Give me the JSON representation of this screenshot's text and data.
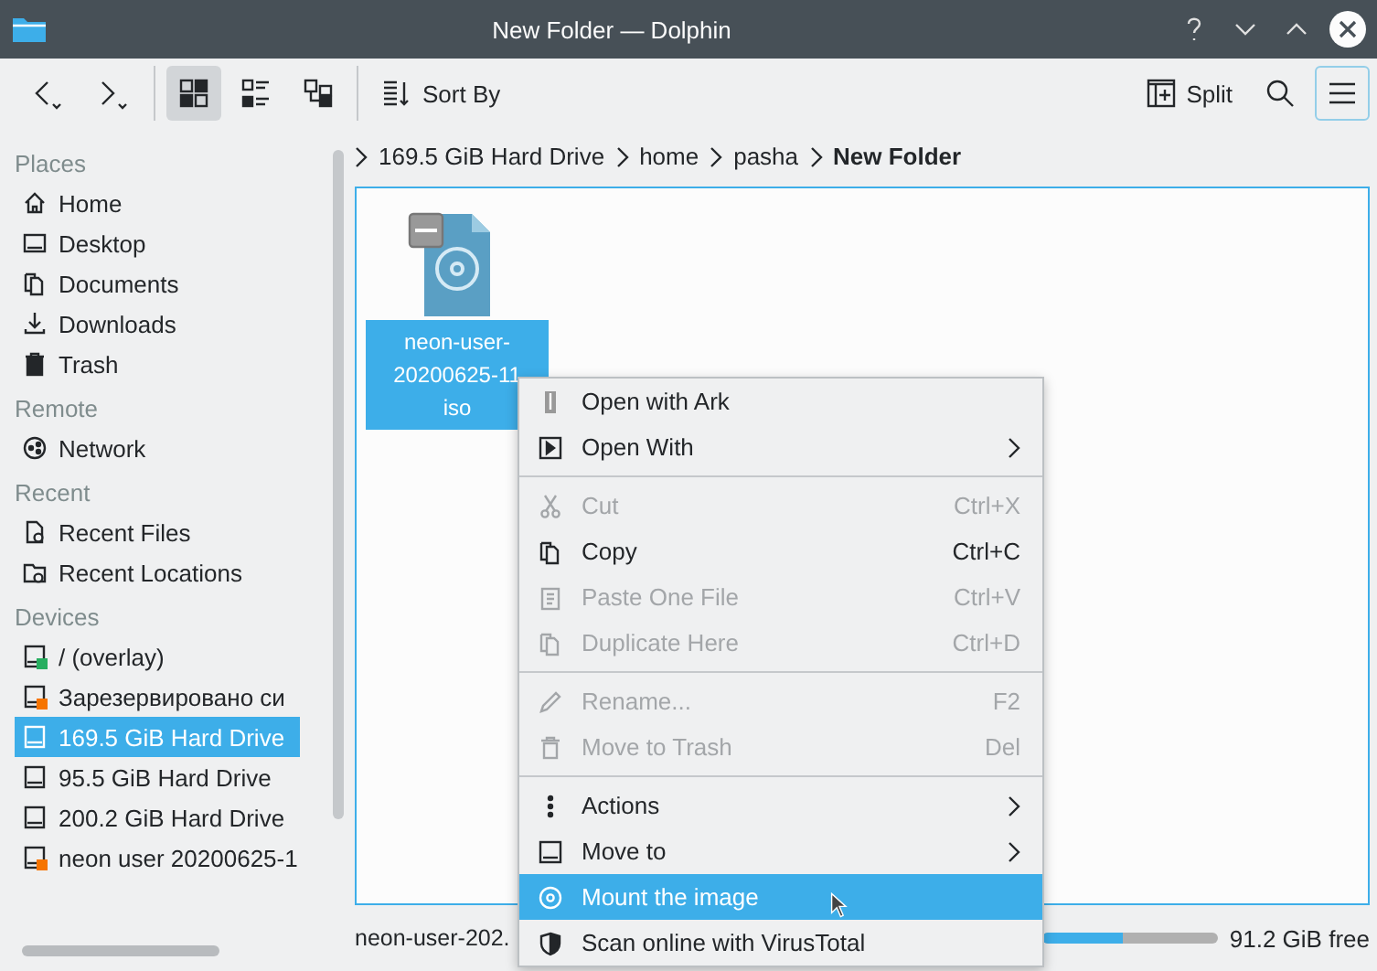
{
  "window": {
    "title": "New Folder — Dolphin"
  },
  "toolbar": {
    "views": [
      {
        "selected": true
      },
      {
        "selected": false
      },
      {
        "selected": false
      }
    ],
    "sort_label": "Sort By",
    "split_label": "Split"
  },
  "sidebar": {
    "sections": [
      {
        "title": "Places",
        "items": [
          {
            "label": "Home",
            "selected": false
          },
          {
            "label": "Desktop",
            "selected": false
          },
          {
            "label": "Documents",
            "selected": false
          },
          {
            "label": "Downloads",
            "selected": false
          },
          {
            "label": "Trash",
            "selected": false
          }
        ]
      },
      {
        "title": "Remote",
        "items": [
          {
            "label": "Network",
            "selected": false
          }
        ]
      },
      {
        "title": "Recent",
        "items": [
          {
            "label": "Recent Files",
            "selected": false
          },
          {
            "label": "Recent Locations",
            "selected": false
          }
        ]
      },
      {
        "title": "Devices",
        "items": [
          {
            "label": "/ (overlay)",
            "selected": false
          },
          {
            "label": "Зарезервировано си",
            "selected": false
          },
          {
            "label": "169.5 GiB Hard Drive",
            "selected": true
          },
          {
            "label": "95.5 GiB Hard Drive",
            "selected": false
          },
          {
            "label": "200.2 GiB Hard Drive",
            "selected": false
          },
          {
            "label": "neon user 20200625-1",
            "selected": false
          }
        ]
      }
    ]
  },
  "breadcrumb": [
    "169.5 GiB Hard Drive",
    "home",
    "pasha",
    "New Folder"
  ],
  "file": {
    "lines": [
      "neon-user-",
      "20200625-11",
      "iso"
    ],
    "selected": true
  },
  "status_bar": {
    "text": "neon-user-202.",
    "free": "91.2 GiB free",
    "level": 0.45
  },
  "context_menu": [
    {
      "kind": "item",
      "label": "Open with Ark",
      "disabled": false,
      "submenu": false,
      "selected": false
    },
    {
      "kind": "item",
      "label": "Open With",
      "disabled": false,
      "submenu": true,
      "selected": false
    },
    {
      "kind": "separator"
    },
    {
      "kind": "item",
      "label": "Cut",
      "shortcut": "Ctrl+X",
      "disabled": true,
      "submenu": false,
      "selected": false
    },
    {
      "kind": "item",
      "label": "Copy",
      "shortcut": "Ctrl+C",
      "disabled": false,
      "submenu": false,
      "selected": false
    },
    {
      "kind": "item",
      "label": "Paste One File",
      "shortcut": "Ctrl+V",
      "disabled": true,
      "submenu": false,
      "selected": false
    },
    {
      "kind": "item",
      "label": "Duplicate Here",
      "shortcut": "Ctrl+D",
      "disabled": true,
      "submenu": false,
      "selected": false
    },
    {
      "kind": "separator"
    },
    {
      "kind": "item",
      "label": "Rename...",
      "shortcut": "F2",
      "disabled": true,
      "submenu": false,
      "selected": false
    },
    {
      "kind": "item",
      "label": "Move to Trash",
      "shortcut": "Del",
      "disabled": true,
      "submenu": false,
      "selected": false
    },
    {
      "kind": "separator"
    },
    {
      "kind": "item",
      "label": "Actions",
      "disabled": false,
      "submenu": true,
      "selected": false
    },
    {
      "kind": "item",
      "label": "Move to",
      "disabled": false,
      "submenu": true,
      "selected": false
    },
    {
      "kind": "item",
      "label": "Mount the image",
      "disabled": false,
      "submenu": false,
      "selected": true
    },
    {
      "kind": "item",
      "label": "Scan online with VirusTotal",
      "disabled": false,
      "submenu": false,
      "selected": false
    }
  ]
}
